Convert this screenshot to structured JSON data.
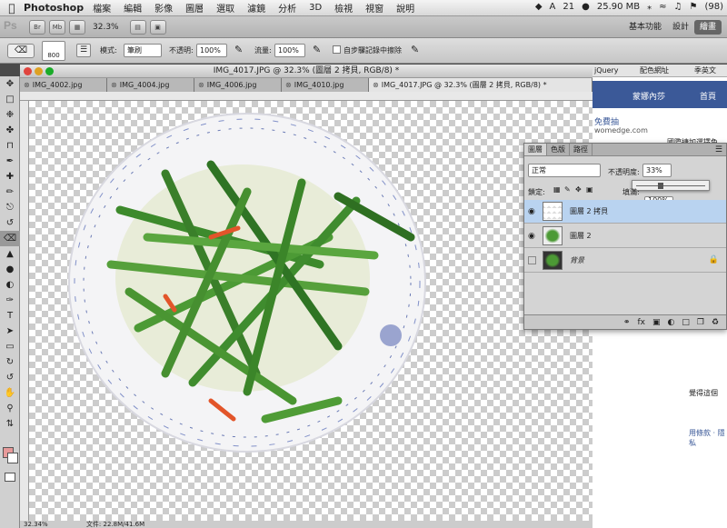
{
  "menubar": {
    "app_name": "Photoshop",
    "items": [
      "檔案",
      "編輯",
      "影像",
      "圖層",
      "選取",
      "濾鏡",
      "分析",
      "3D",
      "檢視",
      "視窗",
      "說明"
    ],
    "status": {
      "adobe_count": "21",
      "memory": "25.90 MB",
      "battery": "(98)"
    }
  },
  "appbar": {
    "logo": "Ps",
    "bridge_label": "Br",
    "minibridge_label": "Mb",
    "zoom": "32.3%",
    "workspaces": [
      "基本功能",
      "設計",
      "繪畫"
    ]
  },
  "options": {
    "brush_size": "800",
    "mode_label": "模式:",
    "mode_value": "筆刷",
    "opacity_label": "不透明:",
    "opacity_value": "100%",
    "flow_label": "流量:",
    "flow_value": "100%",
    "erase_history_label": "自步驟記錄中擦除"
  },
  "document": {
    "title": "IMG_4017.JPG @ 32.3% (圖層 2 拷貝, RGB/8) *",
    "tabs": [
      {
        "label": "IMG_4002.jpg"
      },
      {
        "label": "IMG_4004.jpg"
      },
      {
        "label": "IMG_4006.jpg"
      },
      {
        "label": "IMG_4010.jpg"
      },
      {
        "label": "IMG_4017.JPG @ 32.3% (圖層 2 拷貝, RGB/8) *"
      }
    ],
    "status_zoom": "32.34%",
    "status_file": "文件: 22.8M/41.6M"
  },
  "layers_panel": {
    "tabs": [
      "圖層",
      "色版",
      "路徑"
    ],
    "blend_mode": "正常",
    "opacity_label": "不透明度:",
    "opacity_value": "33%",
    "lock_label": "鎖定:",
    "fill_label": "填滿:",
    "fill_value": "100%",
    "layers": [
      {
        "name": "圖層 2 拷貝",
        "selected": true
      },
      {
        "name": "圖層 2",
        "selected": false
      },
      {
        "name": "背景",
        "selected": false
      }
    ]
  },
  "browser": {
    "bookmarks": [
      "jQuery",
      "配色網址",
      "季英文"
    ],
    "user_name": "蒙娜內莎",
    "home_link": "首頁",
    "snippets": [
      "免費抽",
      "womedge.com",
      "國際捷加選擇免"
    ],
    "footer_text": [
      "用條款 · 隱私",
      "覺得這個"
    ]
  },
  "colors": {
    "foreground": "#e79a9a",
    "background": "#ffffff",
    "selection": "#b9d3f0"
  }
}
